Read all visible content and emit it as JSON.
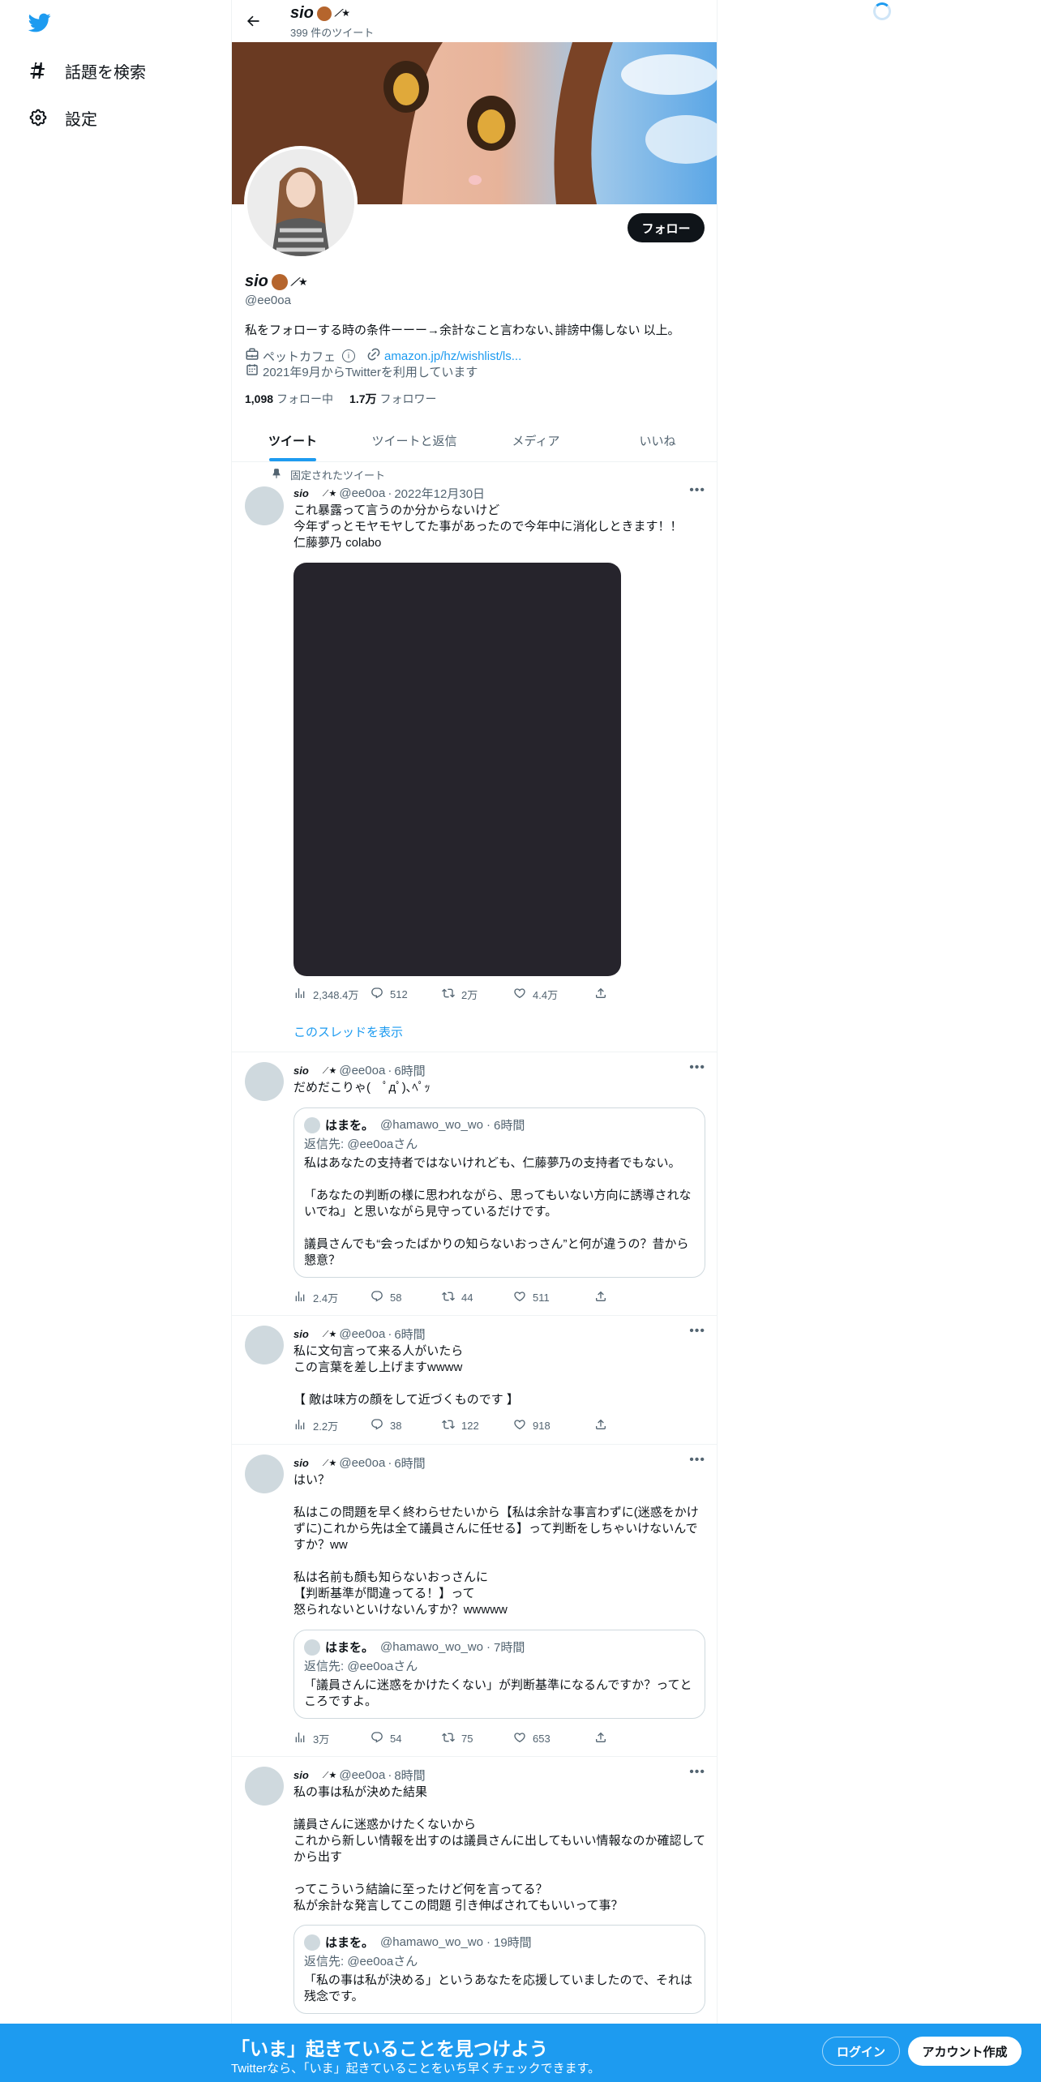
{
  "nav": {
    "explore_label": "話題を検索",
    "settings_label": "設定"
  },
  "header": {
    "name": "sio",
    "tweet_count": "399 件のツイート"
  },
  "profile": {
    "name": "sio",
    "handle": "@ee0oa",
    "follow_label": "フォロー",
    "bio": "私をフォローする時の条件ーーー→余計なこと言わない､誹謗中傷しない 以上｡",
    "category": "ペットカフェ",
    "link": "amazon.jp/hz/wishlist/ls...",
    "joined": "2021年9月からTwitterを利用しています",
    "following_count": "1,098",
    "following_label": "フォロー中",
    "followers_count": "1.7万",
    "followers_label": "フォロワー"
  },
  "tabs": [
    "ツイート",
    "ツイートと返信",
    "メディア",
    "いいね"
  ],
  "pinned_label": "固定されたツイート",
  "thread_link": "このスレッドを表示",
  "tweets": [
    {
      "name": "sio",
      "handle": "@ee0oa",
      "time": "2022年12月30日",
      "text": "これ暴露って言うのか分からないけど\n今年ずっとモヤモヤしてた事があったので今年中に消化しときます！！\n仁藤夢乃 colabo",
      "views": "2,348.4万",
      "replies": "512",
      "retweets": "2万",
      "likes": "4.4万"
    },
    {
      "name": "sio",
      "handle": "@ee0oa",
      "time": "6時間",
      "text": "だめだこりゃ(　ﾟдﾟ)､ﾍﾟｯ",
      "quote": {
        "name": "はまを。",
        "handle": "@hamawo_wo_wo",
        "time": "6時間",
        "reply_to": "返信先: @ee0oaさん",
        "text": "私はあなたの支持者ではないけれども、仁藤夢乃の支持者でもない。\n\n「あなたの判断の様に思われながら、思ってもいない方向に誘導されないでね」と思いながら見守っているだけです。\n\n議員さんでも“会ったばかりの知らないおっさん”と何が違うの？昔から懇意？"
      },
      "views": "2.4万",
      "replies": "58",
      "retweets": "44",
      "likes": "511"
    },
    {
      "name": "sio",
      "handle": "@ee0oa",
      "time": "6時間",
      "text": "私に文句言って来る人がいたら\nこの言葉を差し上げますwwww\n\n【 敵は味方の顔をして近づくものです 】",
      "views": "2.2万",
      "replies": "38",
      "retweets": "122",
      "likes": "918"
    },
    {
      "name": "sio",
      "handle": "@ee0oa",
      "time": "6時間",
      "text": "はい？\n\n私はこの問題を早く終わらせたいから【私は余計な事言わずに(迷惑をかけずに)これから先は全て議員さんに任せる】って判断をしちゃいけないんですか？ww\n\n私は名前も顔も知らないおっさんに\n【判断基準が間違ってる！】って\n怒られないといけないんすか？wwwww",
      "quote": {
        "name": "はまを。",
        "handle": "@hamawo_wo_wo",
        "time": "7時間",
        "reply_to": "返信先: @ee0oaさん",
        "text": "「議員さんに迷惑をかけたくない」が判断基準になるんですか？ってところですよ。"
      },
      "views": "3万",
      "replies": "54",
      "retweets": "75",
      "likes": "653"
    },
    {
      "name": "sio",
      "handle": "@ee0oa",
      "time": "8時間",
      "text": "私の事は私が決めた結果\n\n議員さんに迷惑かけたくないから\nこれから新しい情報を出すのは議員さんに出してもいい情報なのか確認してから出す\n\nってこういう結論に至ったけど何を言ってる？\n私が余計な発言してこの問題 引き伸ばされてもいいって事？",
      "quote": {
        "name": "はまを。",
        "handle": "@hamawo_wo_wo",
        "time": "19時間",
        "reply_to": "返信先: @ee0oaさん",
        "text": "「私の事は私が決める」というあなたを応援していましたので、それは残念です。"
      }
    }
  ],
  "bottom_bar": {
    "title": "「いま」起きていることを見つけよう",
    "subtitle": "Twitterなら、「いま」起きていることをいち早くチェックできます。",
    "login": "ログイン",
    "signup": "アカウント作成"
  },
  "colors": {
    "accent": "#1d9bf0",
    "dark": "#0f1419",
    "muted": "#536471"
  }
}
